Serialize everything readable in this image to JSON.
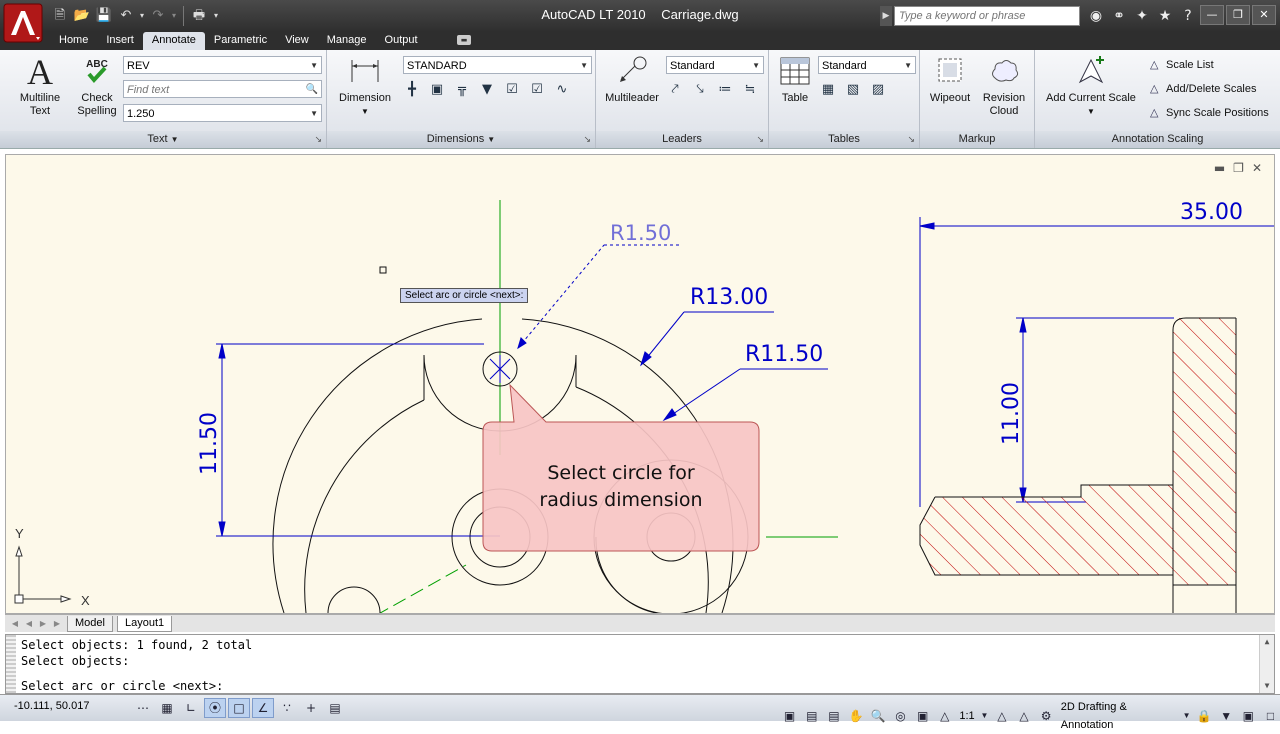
{
  "app": {
    "name": "AutoCAD LT 2010",
    "document": "Carriage.dwg",
    "search_placeholder": "Type a keyword or phrase"
  },
  "tabs": [
    "Home",
    "Insert",
    "Annotate",
    "Parametric",
    "View",
    "Manage",
    "Output"
  ],
  "active_tab": "Annotate",
  "ribbon": {
    "text_panel": {
      "title": "Text",
      "multiline_text": "Multiline Text",
      "check_spelling": "Check Spelling",
      "style": "REV",
      "find_text_placeholder": "Find text",
      "height": "1.250"
    },
    "dimensions_panel": {
      "title": "Dimensions",
      "dimension_label": "Dimension",
      "style": "STANDARD"
    },
    "leaders_panel": {
      "title": "Leaders",
      "multileader_label": "Multileader",
      "style": "Standard"
    },
    "tables_panel": {
      "title": "Tables",
      "table_label": "Table",
      "style": "Standard"
    },
    "markup_panel": {
      "title": "Markup",
      "wipeout": "Wipeout",
      "revision_cloud": "Revision Cloud"
    },
    "scaling_panel": {
      "title": "Annotation Scaling",
      "add_current_scale": "Add Current Scale",
      "scale_list": "Scale List",
      "add_delete_scales": "Add/Delete Scales",
      "sync_scale_positions": "Sync Scale Positions"
    }
  },
  "drawing": {
    "dims": {
      "r150": "R1.50",
      "r1300": "R13.00",
      "r1150": "R11.50",
      "d1150": "11.50",
      "d3500": "35.00",
      "d1100": "11.00"
    },
    "axis_x": "X",
    "axis_y": "Y",
    "tooltip": "Select arc or circle <next>:",
    "callout": "Select circle for radius dimension"
  },
  "layout_tabs": [
    "Model",
    "Layout1"
  ],
  "command_line": {
    "history": [
      "Select objects: 1 found, 2 total",
      "Select objects:"
    ],
    "prompt": "Select arc or circle <next>:"
  },
  "status": {
    "coordinates": "-10.111, 50.017",
    "annotation_scale": "1:1",
    "workspace": "2D Drafting & Annotation"
  },
  "colors": {
    "model_space": "#fdf9ea",
    "dimension_line": "#0000c8",
    "center_line": "#00a000",
    "hatch": "#c00000",
    "callout_fill": "#f7c4c4"
  }
}
